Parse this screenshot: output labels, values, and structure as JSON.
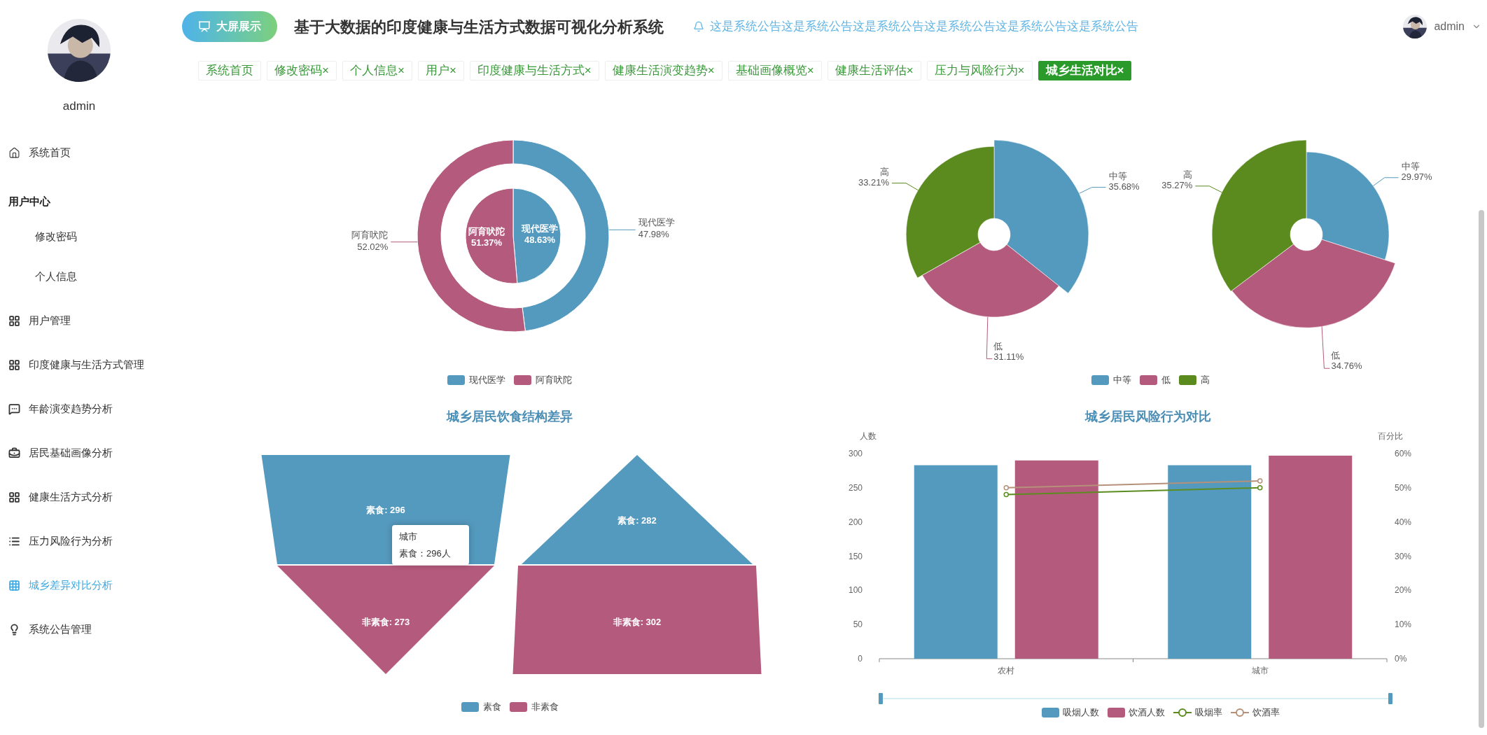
{
  "sidebar": {
    "user_name": "admin",
    "items": [
      {
        "kind": "link",
        "label": "系统首页",
        "selected": false
      },
      {
        "kind": "group",
        "label": "用户中心",
        "children": [
          {
            "label": "修改密码",
            "selected": false
          },
          {
            "label": "个人信息",
            "selected": false
          }
        ]
      },
      {
        "kind": "link",
        "label": "用户管理",
        "selected": false
      },
      {
        "kind": "link",
        "label": "印度健康与生活方式管理",
        "selected": false
      },
      {
        "kind": "link",
        "label": "年龄演变趋势分析",
        "selected": false
      },
      {
        "kind": "link",
        "label": "居民基础画像分析",
        "selected": false
      },
      {
        "kind": "link",
        "label": "健康生活方式分析",
        "selected": false
      },
      {
        "kind": "link",
        "label": "压力风险行为分析",
        "selected": false
      },
      {
        "kind": "link",
        "label": "城乡差异对比分析",
        "selected": true
      },
      {
        "kind": "link",
        "label": "系统公告管理",
        "selected": false
      }
    ]
  },
  "header": {
    "big_screen_button": "大屏展示",
    "title": "基于大数据的印度健康与生活方式数据可视化分析系统",
    "notice": "这是系统公告这是系统公告这是系统公告这是系统公告这是系统公告这是系统公告",
    "user_name": "admin"
  },
  "tabs": [
    {
      "label": "系统首页",
      "selected": false
    },
    {
      "label": "修改密码",
      "close": "×",
      "selected": false
    },
    {
      "label": "个人信息",
      "close": "×",
      "selected": false
    },
    {
      "label": "用户",
      "close": "×",
      "selected": false
    },
    {
      "label": "印度健康与生活方式",
      "close": "×",
      "selected": false
    },
    {
      "label": "健康生活演变趋势",
      "close": "×",
      "selected": false
    },
    {
      "label": "基础画像概览",
      "close": "×",
      "selected": false
    },
    {
      "label": "健康生活评估",
      "close": "×",
      "selected": false
    },
    {
      "label": "压力与风险行为",
      "close": "×",
      "selected": false
    },
    {
      "label": "城乡生活对比",
      "close": "×",
      "selected": true
    }
  ],
  "medicine_chart": {
    "chart_data": {
      "type": "donut",
      "categories": [
        "现代医学",
        "阿育吠陀"
      ],
      "colors": [
        "#5499be",
        "#b45b7d"
      ],
      "data_labels": true,
      "series": [
        {
          "values": [
            48.63,
            51.37
          ],
          "value_labels": [
            "48.63%",
            "51.37%"
          ]
        },
        {
          "values": [
            47.98,
            52.02
          ],
          "value_labels": [
            "47.98%",
            "52.02%"
          ]
        }
      ]
    }
  },
  "level_charts": {
    "charts": [
      {
        "chart_data": {
          "type": "donut",
          "categories": [
            "中等",
            "低",
            "高"
          ],
          "colors": [
            "#5499be",
            "#b45b7d",
            "#5b8a1e"
          ],
          "values": [
            35.68,
            31.11,
            33.21
          ],
          "value_labels": [
            "35.68%",
            "31.11%",
            "33.21%"
          ]
        }
      },
      {
        "chart_data": {
          "type": "donut",
          "categories": [
            "中等",
            "低",
            "高"
          ],
          "colors": [
            "#5499be",
            "#b45b7d",
            "#5b8a1e"
          ],
          "values": [
            29.97,
            34.76,
            35.27
          ],
          "value_labels": [
            "29.97%",
            "34.76%",
            "35.27%"
          ]
        }
      }
    ],
    "legend": [
      {
        "label": "中等",
        "color": "#5499be"
      },
      {
        "label": "低",
        "color": "#b45b7d"
      },
      {
        "label": "高",
        "color": "#5b8a1e"
      }
    ]
  },
  "diet_chart": {
    "title": "城乡居民饮食结构差异",
    "funnels": [
      {
        "kind": "funnel",
        "segments": [
          {
            "label": "素食: 296",
            "color": "#5499be"
          },
          {
            "label": "非素食: 273",
            "color": "#b45b7d"
          }
        ]
      },
      {
        "kind": "pyramid",
        "segments": [
          {
            "label": "素食: 282",
            "color": "#5499be"
          },
          {
            "label": "非素食: 302",
            "color": "#b45b7d"
          }
        ]
      }
    ],
    "tooltip": {
      "title": "城市",
      "line": "素食：296人"
    },
    "legend": [
      {
        "label": "素食",
        "color": "#5499be"
      },
      {
        "label": "非素食",
        "color": "#b45b7d"
      }
    ]
  },
  "risk_chart": {
    "title": "城乡居民风险行为对比",
    "chart_data": {
      "type": "bar",
      "categories": [
        "农村",
        "城市"
      ],
      "ylabel": "人数",
      "ylim": [
        0,
        300
      ],
      "yticks": [
        0,
        50,
        100,
        150,
        200,
        250,
        300
      ],
      "y2label": "百分比",
      "y2lim": [
        0,
        60
      ],
      "y2ticks": [
        {
          "value": 0,
          "label": "0%"
        },
        {
          "value": 10,
          "label": "10%"
        },
        {
          "value": 20,
          "label": "20%"
        },
        {
          "value": 30,
          "label": "30%"
        },
        {
          "value": 40,
          "label": "40%"
        },
        {
          "value": 50,
          "label": "50%"
        },
        {
          "value": 60,
          "label": "60%"
        }
      ],
      "series": [
        {
          "name": "吸烟人数",
          "type": "bar",
          "color": "#5499be",
          "values": [
            283,
            283
          ]
        },
        {
          "name": "饮酒人数",
          "type": "bar",
          "color": "#b45b7d",
          "values": [
            290,
            297
          ]
        },
        {
          "name": "吸烟率",
          "type": "line",
          "axis": "y2",
          "marker": "o",
          "color": "#5b8c1f",
          "values": [
            48,
            50
          ]
        },
        {
          "name": "饮酒率",
          "type": "line",
          "axis": "y2",
          "marker": "o",
          "color": "#b5917a",
          "values": [
            50,
            52
          ]
        }
      ]
    }
  }
}
